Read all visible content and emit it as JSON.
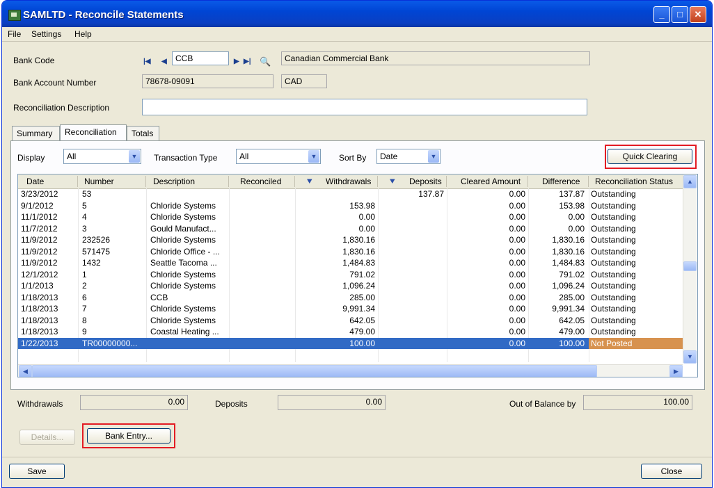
{
  "window": {
    "title": "SAMLTD - Reconcile Statements",
    "controls": [
      "minimize",
      "maximize",
      "close"
    ]
  },
  "menu": [
    "File",
    "Settings",
    "Help"
  ],
  "header": {
    "bank_code_label": "Bank Code",
    "bank_code": "CCB",
    "bank_name": "Canadian Commercial Bank",
    "account_label": "Bank Account Number",
    "account_number": "78678-09091",
    "currency": "CAD",
    "desc_label": "Reconciliation Description",
    "description": ""
  },
  "tabs": [
    "Summary",
    "Reconciliation",
    "Totals"
  ],
  "active_tab": "Reconciliation",
  "filters": {
    "display_label": "Display",
    "display_value": "All",
    "type_label": "Transaction Type",
    "type_value": "All",
    "sort_label": "Sort By",
    "sort_value": "Date",
    "quick_clearing": "Quick Clearing"
  },
  "table": {
    "columns": [
      "Date",
      "Number",
      "Description",
      "Reconciled",
      "Withdrawals",
      "Deposits",
      "Cleared Amount",
      "Difference",
      "Reconciliation Status"
    ],
    "rows": [
      [
        "3/23/2012",
        "53",
        "",
        "",
        "",
        "137.87",
        "0.00",
        "137.87",
        "Outstanding"
      ],
      [
        "9/1/2012",
        "5",
        "Chloride Systems",
        "",
        "153.98",
        "",
        "0.00",
        "153.98",
        "Outstanding"
      ],
      [
        "11/1/2012",
        "4",
        "Chloride Systems",
        "",
        "0.00",
        "",
        "0.00",
        "0.00",
        "Outstanding"
      ],
      [
        "11/7/2012",
        "3",
        "Gould Manufact...",
        "",
        "0.00",
        "",
        "0.00",
        "0.00",
        "Outstanding"
      ],
      [
        "11/9/2012",
        "232526",
        "Chloride Systems",
        "",
        "1,830.16",
        "",
        "0.00",
        "1,830.16",
        "Outstanding"
      ],
      [
        "11/9/2012",
        "571475",
        "Chloride Office - ...",
        "",
        "1,830.16",
        "",
        "0.00",
        "1,830.16",
        "Outstanding"
      ],
      [
        "11/9/2012",
        "1432",
        "Seattle Tacoma ...",
        "",
        "1,484.83",
        "",
        "0.00",
        "1,484.83",
        "Outstanding"
      ],
      [
        "12/1/2012",
        "1",
        "Chloride Systems",
        "",
        "791.02",
        "",
        "0.00",
        "791.02",
        "Outstanding"
      ],
      [
        "1/1/2013",
        "2",
        "Chloride Systems",
        "",
        "1,096.24",
        "",
        "0.00",
        "1,096.24",
        "Outstanding"
      ],
      [
        "1/18/2013",
        "6",
        "CCB",
        "",
        "285.00",
        "",
        "0.00",
        "285.00",
        "Outstanding"
      ],
      [
        "1/18/2013",
        "7",
        "Chloride Systems",
        "",
        "9,991.34",
        "",
        "0.00",
        "9,991.34",
        "Outstanding"
      ],
      [
        "1/18/2013",
        "8",
        "Chloride Systems",
        "",
        "642.05",
        "",
        "0.00",
        "642.05",
        "Outstanding"
      ],
      [
        "1/18/2013",
        "9",
        "Coastal Heating ...",
        "",
        "479.00",
        "",
        "0.00",
        "479.00",
        "Outstanding"
      ],
      [
        "1/22/2013",
        "TR00000000...",
        "",
        "",
        "100.00",
        "",
        "0.00",
        "100.00",
        "Not Posted"
      ]
    ],
    "selected_row": 13
  },
  "totals": {
    "withdrawals_label": "Withdrawals",
    "withdrawals": "0.00",
    "deposits_label": "Deposits",
    "deposits": "0.00",
    "oob_label": "Out of Balance by",
    "oob": "100.00"
  },
  "buttons": {
    "details": "Details...",
    "bank_entry": "Bank Entry...",
    "save": "Save",
    "close": "Close"
  },
  "colors": {
    "title_bar": "#0a5ae8",
    "selection": "#316ac5",
    "not_posted": "#d7924f",
    "highlight_box": "#e31b23"
  }
}
